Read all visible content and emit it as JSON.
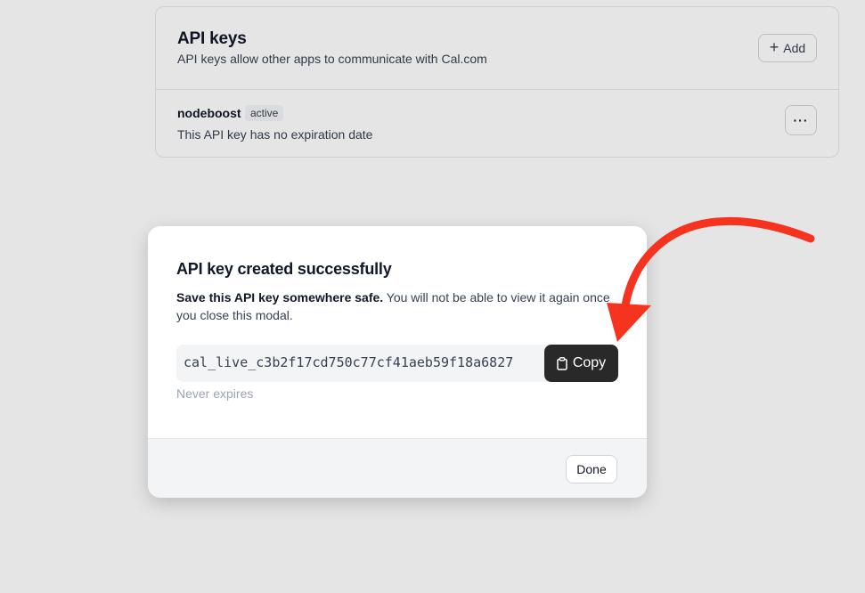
{
  "api_keys_card": {
    "title": "API keys",
    "description": "API keys allow other apps to communicate with Cal.com",
    "add_button_label": "Add",
    "add_icon": "plus-icon",
    "keys": [
      {
        "name": "nodeboost",
        "status": "active",
        "expiration_text": "This API key has no expiration date",
        "more_label": "···"
      }
    ]
  },
  "modal": {
    "title": "API key created successfully",
    "warning_bold": "Save this API key somewhere safe.",
    "warning_rest": " You will not be able to view it again once you close this modal.",
    "api_key": "cal_live_c3b2f17cd750c77cf41aeb59f18a6827",
    "copy_label": "Copy",
    "copy_icon": "clipboard-icon",
    "expiry_text": "Never expires",
    "done_label": "Done"
  },
  "annotation": {
    "arrow_color": "#f5331f",
    "arrow_icon": "red-arrow-icon"
  },
  "colors": {
    "copy_button_bg": "#292929",
    "badge_bg": "#f3f4f6",
    "footer_bg": "#f3f4f6"
  }
}
